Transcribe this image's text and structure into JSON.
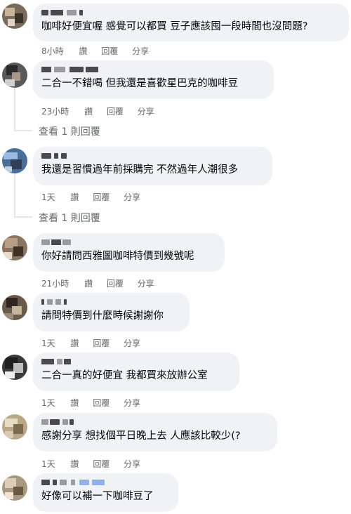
{
  "comments": [
    {
      "text": "咖啡好便宜喔 感覺可以都買 豆子應該囤一段時間也沒問題?",
      "time": "8小時",
      "like": "讚",
      "reply": "回覆",
      "share": "分享"
    },
    {
      "text": "二合一不錯喝 但我還是喜歡星巴克的咖啡豆",
      "time": "23小時",
      "like": "讚",
      "reply": "回覆",
      "share": "分享"
    },
    {
      "text": "我還是習慣過年前採購完 不然過年人潮很多",
      "time": "1天",
      "like": "讚",
      "reply": "回覆",
      "share": "分享"
    },
    {
      "text": "你好請問西雅圖咖啡特價到幾號呢",
      "time": "21小時",
      "like": "讚",
      "reply": "回覆",
      "share": "分享"
    },
    {
      "text": "請問特價到什麼時候謝謝你",
      "time": "1天",
      "like": "讚",
      "reply": "回覆",
      "share": "分享"
    },
    {
      "text": "二合一真的好便宜 我都買來放辦公室",
      "time": "1天",
      "like": "讚",
      "reply": "回覆",
      "share": "分享"
    },
    {
      "text": "感謝分享 想找個平日晚上去 人應該比較少(?",
      "time": "1天",
      "like": "讚",
      "reply": "回覆",
      "share": "分享"
    },
    {
      "text": "好像可以補一下咖啡豆了"
    }
  ],
  "view_replies": [
    "查看 1 則回覆",
    "查看 1 則回覆"
  ]
}
